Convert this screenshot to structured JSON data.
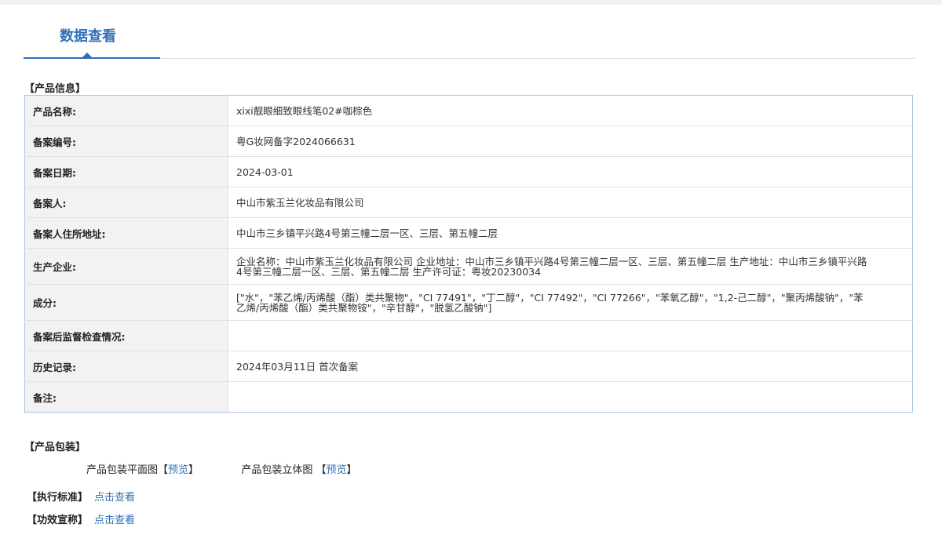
{
  "header": {
    "title": "数据查看"
  },
  "product_info": {
    "section_title": "【产品信息】",
    "rows": [
      {
        "label": "产品名称:",
        "value": "xixi靓眼细致眼线笔02#咖棕色"
      },
      {
        "label": "备案编号:",
        "value": "粤G妆网备字2024066631"
      },
      {
        "label": "备案日期:",
        "value": "2024-03-01"
      },
      {
        "label": "备案人:",
        "value": "中山市紫玉兰化妆品有限公司"
      },
      {
        "label": "备案人住所地址:",
        "value": "中山市三乡镇平兴路4号第三幢二层一区、三层、第五幢二层"
      },
      {
        "label": "生产企业:",
        "value": "企业名称：中山市紫玉兰化妆品有限公司 企业地址：中山市三乡镇平兴路4号第三幢二层一区、三层、第五幢二层 生产地址：中山市三乡镇平兴路4号第三幢二层一区、三层、第五幢二层 生产许可证：粤妆20230034"
      },
      {
        "label": "成分:",
        "value": "[\"水\"，\"苯乙烯/丙烯酸（酯）类共聚物\"，\"CI 77491\"，\"丁二醇\"，\"CI 77492\"，\"CI 77266\"，\"苯氧乙醇\"，\"1,2-己二醇\"，\"聚丙烯酸钠\"，\"苯乙烯/丙烯酸（酯）类共聚物铵\"，\"辛甘醇\"，\"脱氢乙酸钠\"]"
      },
      {
        "label": "备案后监督检查情况:",
        "value": ""
      },
      {
        "label": "历史记录:",
        "value": "2024年03月11日 首次备案"
      },
      {
        "label": "备注:",
        "value": ""
      }
    ]
  },
  "packaging": {
    "section_title": "【产品包装】",
    "flat_label": "产品包装平面图",
    "flat_bracket_open": "【",
    "flat_link": "预览",
    "flat_bracket_close": "】",
    "stereo_label": "产品包装立体图",
    "stereo_bracket_open": "【",
    "stereo_link": "预览",
    "stereo_bracket_close": "】"
  },
  "standard": {
    "label": "【执行标准】",
    "link": "点击查看"
  },
  "efficacy": {
    "label": "【功效宣称】",
    "link": "点击查看"
  },
  "colors": {
    "accent": "#2f6fb8",
    "label_bg": "#f2f2f2",
    "table_border": "#aac3de"
  }
}
